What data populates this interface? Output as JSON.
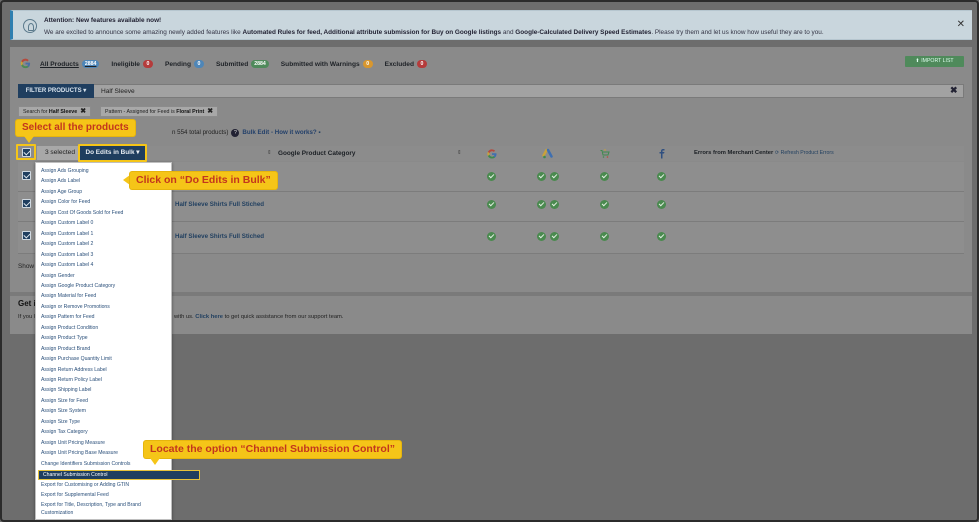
{
  "notice": {
    "title": "Attention: New features available now!",
    "text_prefix": "We are excited to announce some amazing newly added features like ",
    "text_bold": "Automated Rules for feed, Additional attribute submission for Buy on Google listings",
    "text_mid": " and ",
    "text_bold2": "Google-Calculated Delivery Speed Estimates",
    "text_suffix": ". Please try them and let us know how useful they are to you.",
    "close": "✕"
  },
  "tabs": [
    {
      "label": "All Products",
      "count": "2884",
      "color": "#4e86b8"
    },
    {
      "label": "Ineligible",
      "count": "0",
      "color": "#b53b3b"
    },
    {
      "label": "Pending",
      "count": "0",
      "color": "#4e86b8"
    },
    {
      "label": "Submitted",
      "count": "2884",
      "color": "#4f8a5b"
    },
    {
      "label": "Submitted with Warnings",
      "count": "0",
      "color": "#d9972e"
    },
    {
      "label": "Excluded",
      "count": "0",
      "color": "#b53b3b"
    }
  ],
  "import_button": "IMPORT LIST",
  "filter": {
    "button": "FILTER PRODUCTS ▾",
    "value": "Half Sleeve",
    "clear": "✖"
  },
  "chips": [
    {
      "prefix": "Search for ",
      "bold": "Half Sleeve",
      "x": "✖"
    },
    {
      "prefix": "Pattern - Assigned for Feed is ",
      "bold": "Floral Print",
      "x": "✖"
    }
  ],
  "selection_info": {
    "text": "n 554 total products)",
    "link": "Bulk Edit - How it works?"
  },
  "table": {
    "selected": "3 selected",
    "bulk_button": "Do Edits in Bulk ▾",
    "col_category": "Google Product Category",
    "col_errors": "Errors from Merchant Center",
    "refresh": "⟳ Refresh Product Errors",
    "rows": [
      {
        "product": ""
      },
      {
        "product": "Half Sleeve Shirts Full Stiched"
      },
      {
        "product": "Half Sleeve Shirts Full Stiched"
      }
    ]
  },
  "show_text": "Show",
  "help": {
    "title": "Get i",
    "text_left": "If you l",
    "text_right": "with us. ",
    "link": "Click here",
    "text_end": " to get quick assistance from our support team."
  },
  "menu_items": [
    "Assign Ads Grouping",
    "Assign Ads Label",
    "Assign Age Group",
    "Assign Color for Feed",
    "Assign Cost Of Goods Sold for Feed",
    "Assign Custom Label 0",
    "Assign Custom Label 1",
    "Assign Custom Label 2",
    "Assign Custom Label 3",
    "Assign Custom Label 4",
    "Assign Gender",
    "Assign Google Product Category",
    "Assign Material for Feed",
    "Assign or Remove Promotions",
    "Assign Pattern for Feed",
    "Assign Product Condition",
    "Assign Product Type",
    "Assign Product Brand",
    "Assign Purchase Quantity Limit",
    "Assign Return Address Label",
    "Assign Return Policy Label",
    "Assign Shipping Label",
    "Assign Size for Feed",
    "Assign Size System",
    "Assign Size Type",
    "Assign Tax Category",
    "Assign Unit Pricing Measure",
    "Assign Unit Pricing Base Measure",
    "Change Identifiers Submission Controls",
    "Channel Submission Control",
    "Export for Customising or Adding GTIN",
    "Export for Supplemental Feed",
    "Export for Title, Description, Type and Brand",
    "Customization"
  ],
  "callouts": {
    "select_all": "Select all the products",
    "do_edits": "Click on “Do Edits in Bulk”",
    "locate": "Locate the option “Channel Submission Control”"
  }
}
